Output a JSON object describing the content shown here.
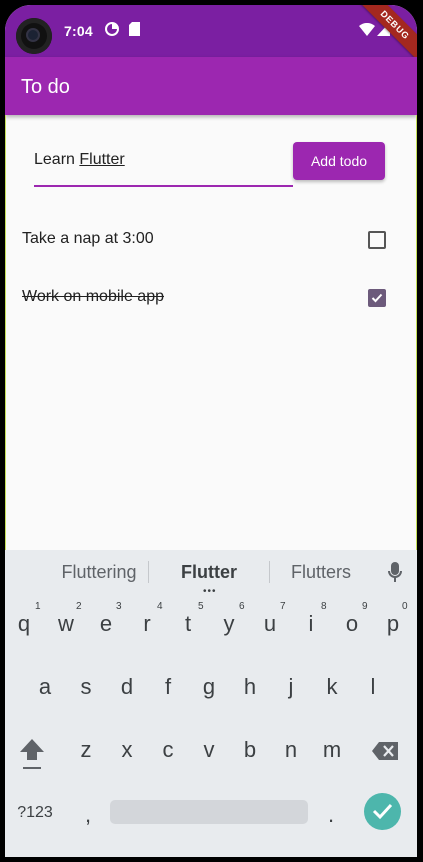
{
  "status_bar": {
    "time": "7:04",
    "debug_banner": "DEBUG",
    "icons": [
      "camera-cutout",
      "data-saver-icon",
      "sd-card-icon",
      "wifi-icon",
      "signal-icon",
      "battery-icon"
    ]
  },
  "app_bar": {
    "title": "To do"
  },
  "input": {
    "value_prefix": "Learn ",
    "value_word": "Flutter"
  },
  "add_button": {
    "label": "Add todo"
  },
  "todos": [
    {
      "label": "Take a nap at 3:00",
      "checked": false
    },
    {
      "label": "Work on mobile app",
      "checked": true
    }
  ],
  "keyboard": {
    "suggestions": [
      "Fluttering",
      "Flutter",
      "Flutters"
    ],
    "row1": [
      "q",
      "w",
      "e",
      "r",
      "t",
      "y",
      "u",
      "i",
      "o",
      "p"
    ],
    "row1_hints": [
      "1",
      "2",
      "3",
      "4",
      "5",
      "6",
      "7",
      "8",
      "9",
      "0"
    ],
    "row2": [
      "a",
      "s",
      "d",
      "f",
      "g",
      "h",
      "j",
      "k",
      "l"
    ],
    "row3": [
      "z",
      "x",
      "c",
      "v",
      "b",
      "n",
      "m"
    ],
    "symbols_key": "?123",
    "comma_key": ",",
    "period_key": ".",
    "icons": [
      "mic-icon",
      "shift-icon",
      "backspace-icon",
      "enter-check-icon"
    ]
  },
  "colors": {
    "primary": "#9c27b0",
    "status_bar": "#7b1fa2",
    "accent_enter": "#4db6ac"
  }
}
